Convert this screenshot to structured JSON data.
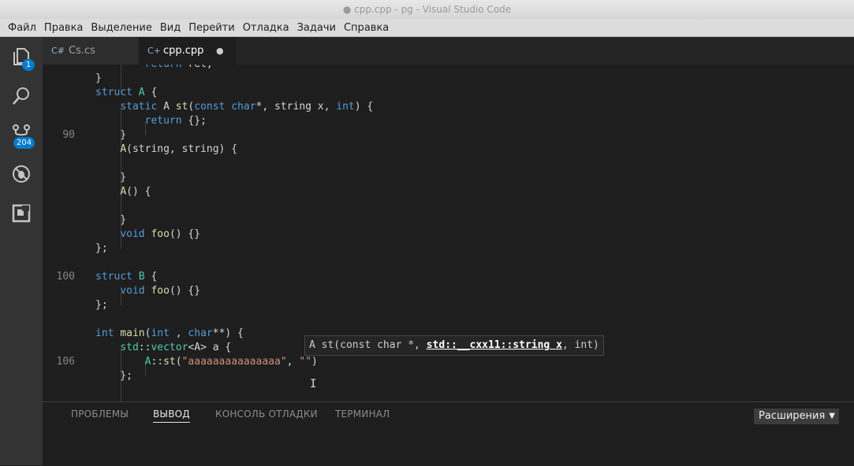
{
  "window": {
    "title": "● cpp.cpp - pg - Visual Studio Code"
  },
  "menu": [
    "Файл",
    "Правка",
    "Выделение",
    "Вид",
    "Перейти",
    "Отладка",
    "Задачи",
    "Справка"
  ],
  "activity": {
    "explorer_badge": "1",
    "scm_badge": "204"
  },
  "tabs": [
    {
      "icon": "C#",
      "label": "Cs.cs"
    },
    {
      "icon": "C+",
      "label": "cpp.cpp",
      "dirty": "●"
    }
  ],
  "code": {
    "line_numbers": {
      "l90": "90",
      "l100": "100",
      "l106": "106"
    }
  },
  "hover": {
    "prefix": "A st(const char *, ",
    "active_param": "std::__cxx11::string x",
    "suffix": ", int)"
  },
  "cursor_glyph": "I",
  "panel": {
    "tabs": [
      "ПРОБЛЕМЫ",
      "ВЫВОД",
      "КОНСОЛЬ ОТЛАДКИ",
      "ТЕРМИНАЛ"
    ],
    "active_tab": "ВЫВОД",
    "output_select": "Расширения",
    "select_arrow": "▼"
  },
  "colors": {
    "keyword": "#569cd6",
    "function": "#dcdcaa",
    "string": "#ce9178",
    "badge": "#007acc"
  }
}
